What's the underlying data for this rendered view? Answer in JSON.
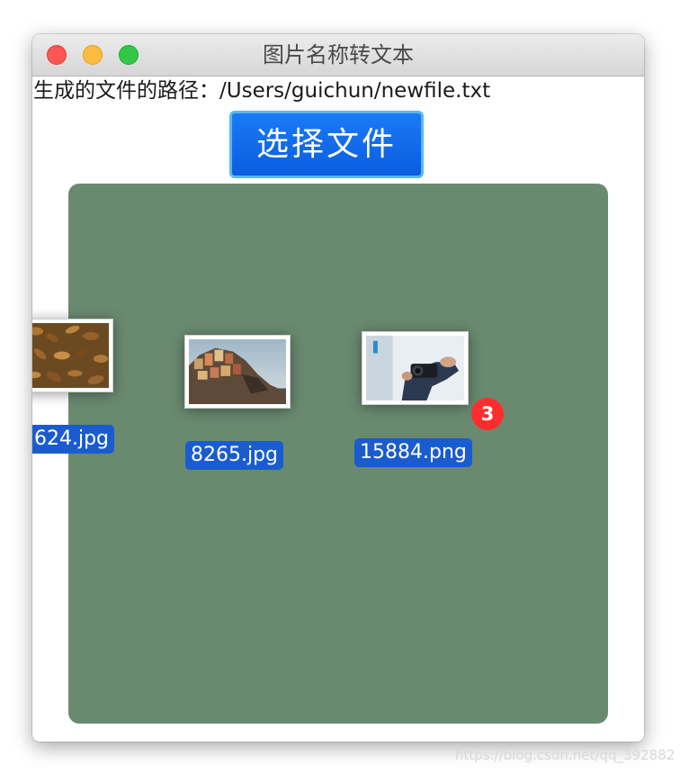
{
  "window": {
    "title": "图片名称转文本"
  },
  "path_label": "生成的文件的路径：/Users/guichun/newfile.txt",
  "select_button_label": "选择文件",
  "dragged_files": [
    {
      "name": "624.jpg"
    },
    {
      "name": "8265.jpg"
    },
    {
      "name": "15884.png"
    }
  ],
  "drag_count_badge": "3",
  "watermark": "https://blog.csdn.net/qq_392882",
  "colors": {
    "drop_area": "#6a8a70",
    "button": "#0a5ddf",
    "filename_label": "#1a5ccf",
    "badge": "#ff2d2d"
  },
  "icons": [
    "close-light",
    "minimize-light",
    "zoom-light"
  ]
}
